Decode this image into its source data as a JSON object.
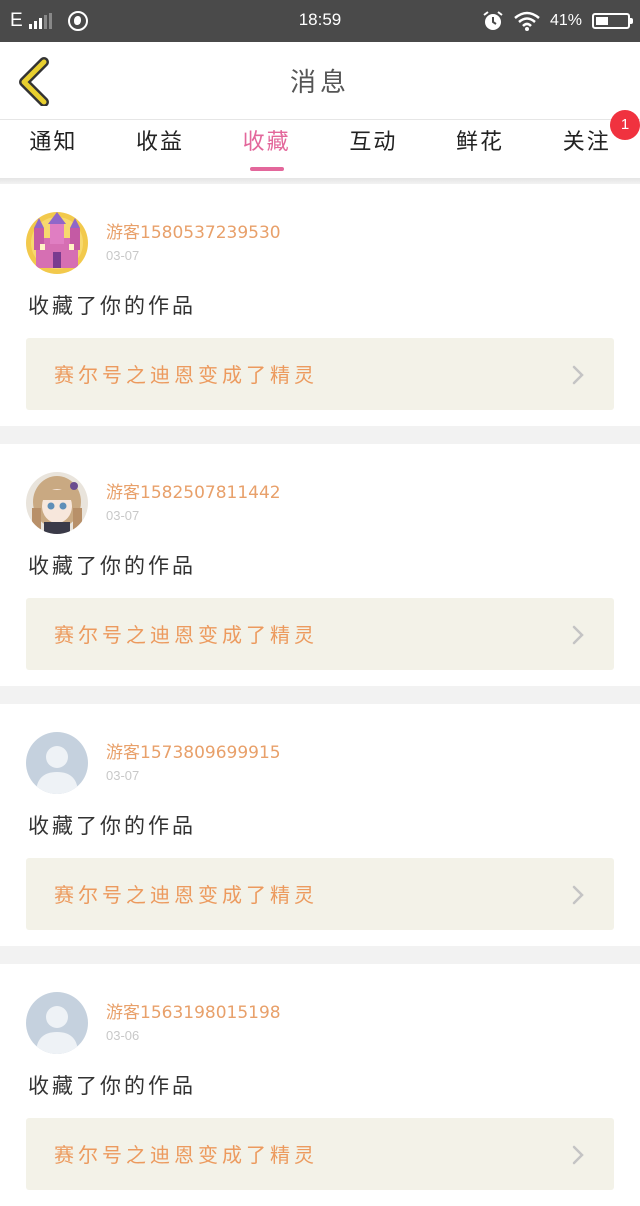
{
  "status_bar": {
    "network": "E",
    "time": "18:59",
    "battery": "41%",
    "battery_level": 0.41
  },
  "header": {
    "title": "消息",
    "back_icon": "chevron-left-icon",
    "accent_color": "#e8cf2f"
  },
  "tabs": [
    {
      "label": "通知",
      "active": false
    },
    {
      "label": "收益",
      "active": false
    },
    {
      "label": "收藏",
      "active": true
    },
    {
      "label": "互动",
      "active": false
    },
    {
      "label": "鲜花",
      "active": false
    },
    {
      "label": "关注",
      "active": false,
      "badge": "1"
    }
  ],
  "theme": {
    "active_tab_color": "#e3679b",
    "username_color": "#e8a06a",
    "work_title_color": "#ec9a5e",
    "badge_color": "#f0323f"
  },
  "messages": [
    {
      "username": "游客1580537239530",
      "date": "03-07",
      "action": "收藏了你的作品",
      "work_title": "赛尔号之迪恩变成了精灵",
      "avatar": "castle-avatar"
    },
    {
      "username": "游客1582507811442",
      "date": "03-07",
      "action": "收藏了你的作品",
      "work_title": "赛尔号之迪恩变成了精灵",
      "avatar": "anime-girl-avatar"
    },
    {
      "username": "游客1573809699915",
      "date": "03-07",
      "action": "收藏了你的作品",
      "work_title": "赛尔号之迪恩变成了精灵",
      "avatar": "default-user-avatar"
    },
    {
      "username": "游客1563198015198",
      "date": "03-06",
      "action": "收藏了你的作品",
      "work_title": "赛尔号之迪恩变成了精灵",
      "avatar": "default-user-avatar"
    }
  ]
}
